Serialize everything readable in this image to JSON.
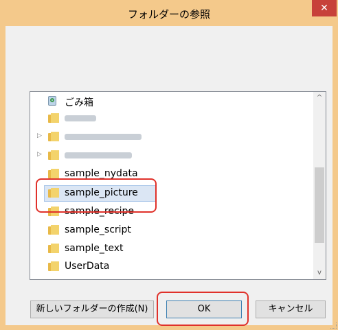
{
  "window": {
    "title": "フォルダーの参照",
    "close_glyph": "✕"
  },
  "tree": {
    "items": [
      {
        "label": "ごみ箱",
        "icon": "recycle-bin-icon",
        "expandable": false,
        "blurred": false
      },
      {
        "label": "",
        "icon": "folder-icon",
        "expandable": false,
        "blurred": true
      },
      {
        "label": "",
        "icon": "folder-icon",
        "expandable": true,
        "blurred": true
      },
      {
        "label": "",
        "icon": "folder-icon",
        "expandable": true,
        "blurred": true
      },
      {
        "label": "sample_nydata",
        "icon": "folder-icon",
        "expandable": false,
        "blurred": false
      },
      {
        "label": "sample_picture",
        "icon": "folder-icon",
        "expandable": false,
        "blurred": false,
        "selected": true
      },
      {
        "label": "sample_recipe",
        "icon": "folder-icon",
        "expandable": false,
        "blurred": false
      },
      {
        "label": "sample_script",
        "icon": "folder-icon",
        "expandable": false,
        "blurred": false
      },
      {
        "label": "sample_text",
        "icon": "folder-icon",
        "expandable": false,
        "blurred": false
      },
      {
        "label": "UserData",
        "icon": "folder-icon",
        "expandable": false,
        "blurred": false
      }
    ],
    "scroll_up_glyph": "^",
    "scroll_down_glyph": "v"
  },
  "buttons": {
    "new_folder": "新しいフォルダーの作成(N)",
    "ok": "OK",
    "cancel": "キャンセル"
  },
  "colors": {
    "titlebar": "#f4c98b",
    "close": "#c7413a",
    "highlight": "#e0312a",
    "selection": "#dbe6f4"
  }
}
